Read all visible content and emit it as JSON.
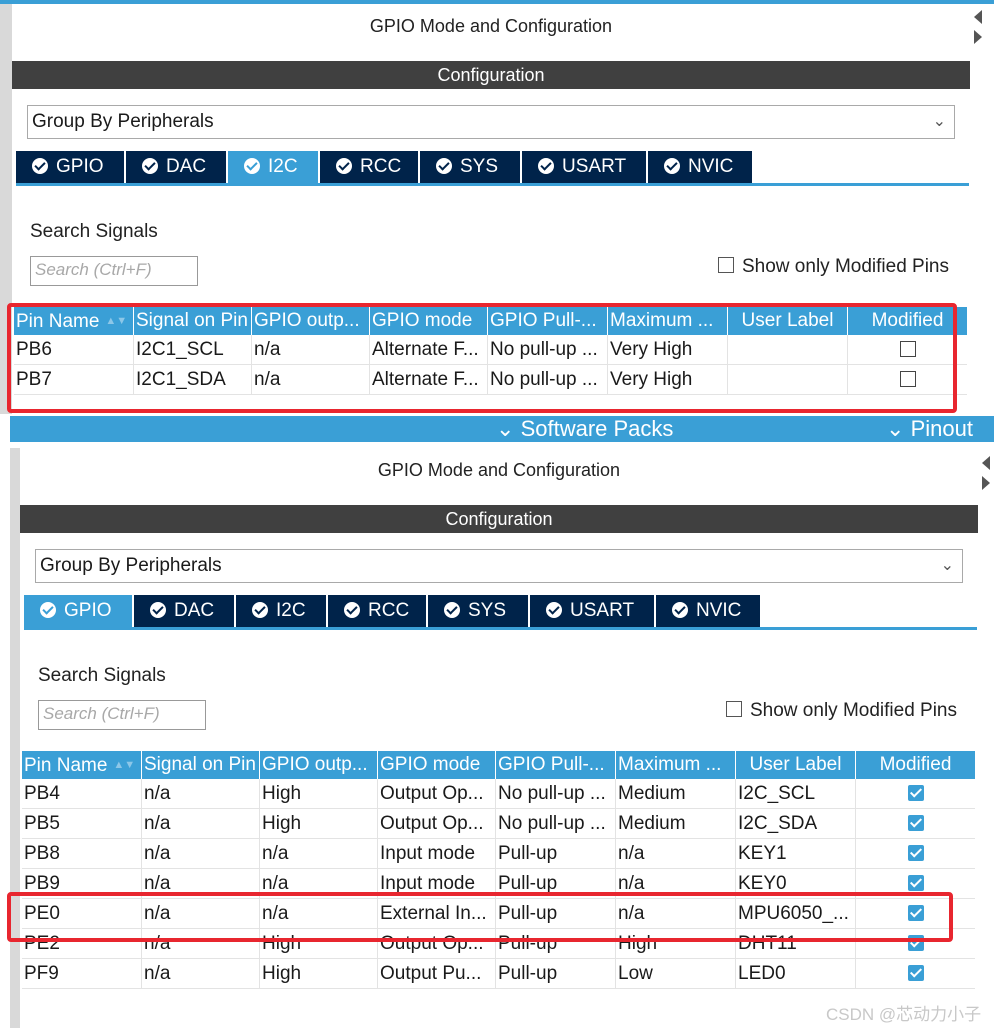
{
  "panels": [
    {
      "title": "GPIO Mode and Configuration",
      "config_bar": "Configuration",
      "group_by": "Group By Peripherals",
      "tabs": [
        {
          "label": "GPIO",
          "active": false
        },
        {
          "label": "DAC",
          "active": false
        },
        {
          "label": "I2C",
          "active": true
        },
        {
          "label": "RCC",
          "active": false
        },
        {
          "label": "SYS",
          "active": false
        },
        {
          "label": "USART",
          "active": false
        },
        {
          "label": "NVIC",
          "active": false
        }
      ],
      "search_label": "Search Signals",
      "search_placeholder": "Search (Ctrl+F)",
      "show_modified": "Show only Modified Pins",
      "columns": [
        "Pin Name",
        "Signal on Pin",
        "GPIO outp...",
        "GPIO mode",
        "GPIO Pull-...",
        "Maximum ...",
        "User Label",
        "Modified"
      ],
      "rows": [
        {
          "pin": "PB6",
          "signal": "I2C1_SCL",
          "output": "n/a",
          "mode": "Alternate F...",
          "pull": "No pull-up ...",
          "speed": "Very High",
          "label": "",
          "modified": false
        },
        {
          "pin": "PB7",
          "signal": "I2C1_SDA",
          "output": "n/a",
          "mode": "Alternate F...",
          "pull": "No pull-up ...",
          "speed": "Very High",
          "label": "",
          "modified": false
        }
      ]
    },
    {
      "title": "GPIO Mode and Configuration",
      "config_bar": "Configuration",
      "group_by": "Group By Peripherals",
      "tabs": [
        {
          "label": "GPIO",
          "active": true
        },
        {
          "label": "DAC",
          "active": false
        },
        {
          "label": "I2C",
          "active": false
        },
        {
          "label": "RCC",
          "active": false
        },
        {
          "label": "SYS",
          "active": false
        },
        {
          "label": "USART",
          "active": false
        },
        {
          "label": "NVIC",
          "active": false
        }
      ],
      "search_label": "Search Signals",
      "search_placeholder": "Search (Ctrl+F)",
      "show_modified": "Show only Modified Pins",
      "columns": [
        "Pin Name",
        "Signal on Pin",
        "GPIO outp...",
        "GPIO mode",
        "GPIO Pull-...",
        "Maximum ...",
        "User Label",
        "Modified"
      ],
      "rows": [
        {
          "pin": "PB4",
          "signal": "n/a",
          "output": "High",
          "mode": "Output Op...",
          "pull": "No pull-up ...",
          "speed": "Medium",
          "label": "I2C_SCL",
          "modified": true
        },
        {
          "pin": "PB5",
          "signal": "n/a",
          "output": "High",
          "mode": "Output Op...",
          "pull": "No pull-up ...",
          "speed": "Medium",
          "label": "I2C_SDA",
          "modified": true
        },
        {
          "pin": "PB8",
          "signal": "n/a",
          "output": "n/a",
          "mode": "Input mode",
          "pull": "Pull-up",
          "speed": "n/a",
          "label": "KEY1",
          "modified": true
        },
        {
          "pin": "PB9",
          "signal": "n/a",
          "output": "n/a",
          "mode": "Input mode",
          "pull": "Pull-up",
          "speed": "n/a",
          "label": "KEY0",
          "modified": true
        },
        {
          "pin": "PE0",
          "signal": "n/a",
          "output": "n/a",
          "mode": "External In...",
          "pull": "Pull-up",
          "speed": "n/a",
          "label": "MPU6050_...",
          "modified": true
        },
        {
          "pin": "PE2",
          "signal": "n/a",
          "output": "High",
          "mode": "Output Op...",
          "pull": "Pull-up",
          "speed": "High",
          "label": "DHT11",
          "modified": true
        },
        {
          "pin": "PF9",
          "signal": "n/a",
          "output": "High",
          "mode": "Output Pu...",
          "pull": "Pull-up",
          "speed": "Low",
          "label": "LED0",
          "modified": true
        }
      ]
    }
  ],
  "nav": {
    "software_packs": "Software Packs",
    "pinout": "Pinout"
  },
  "watermark": "CSDN @芯动力小子",
  "colors": {
    "accent": "#3a9fd6",
    "tab_dark": "#00234a",
    "config_bar": "#404040",
    "highlight": "#e8262f"
  }
}
